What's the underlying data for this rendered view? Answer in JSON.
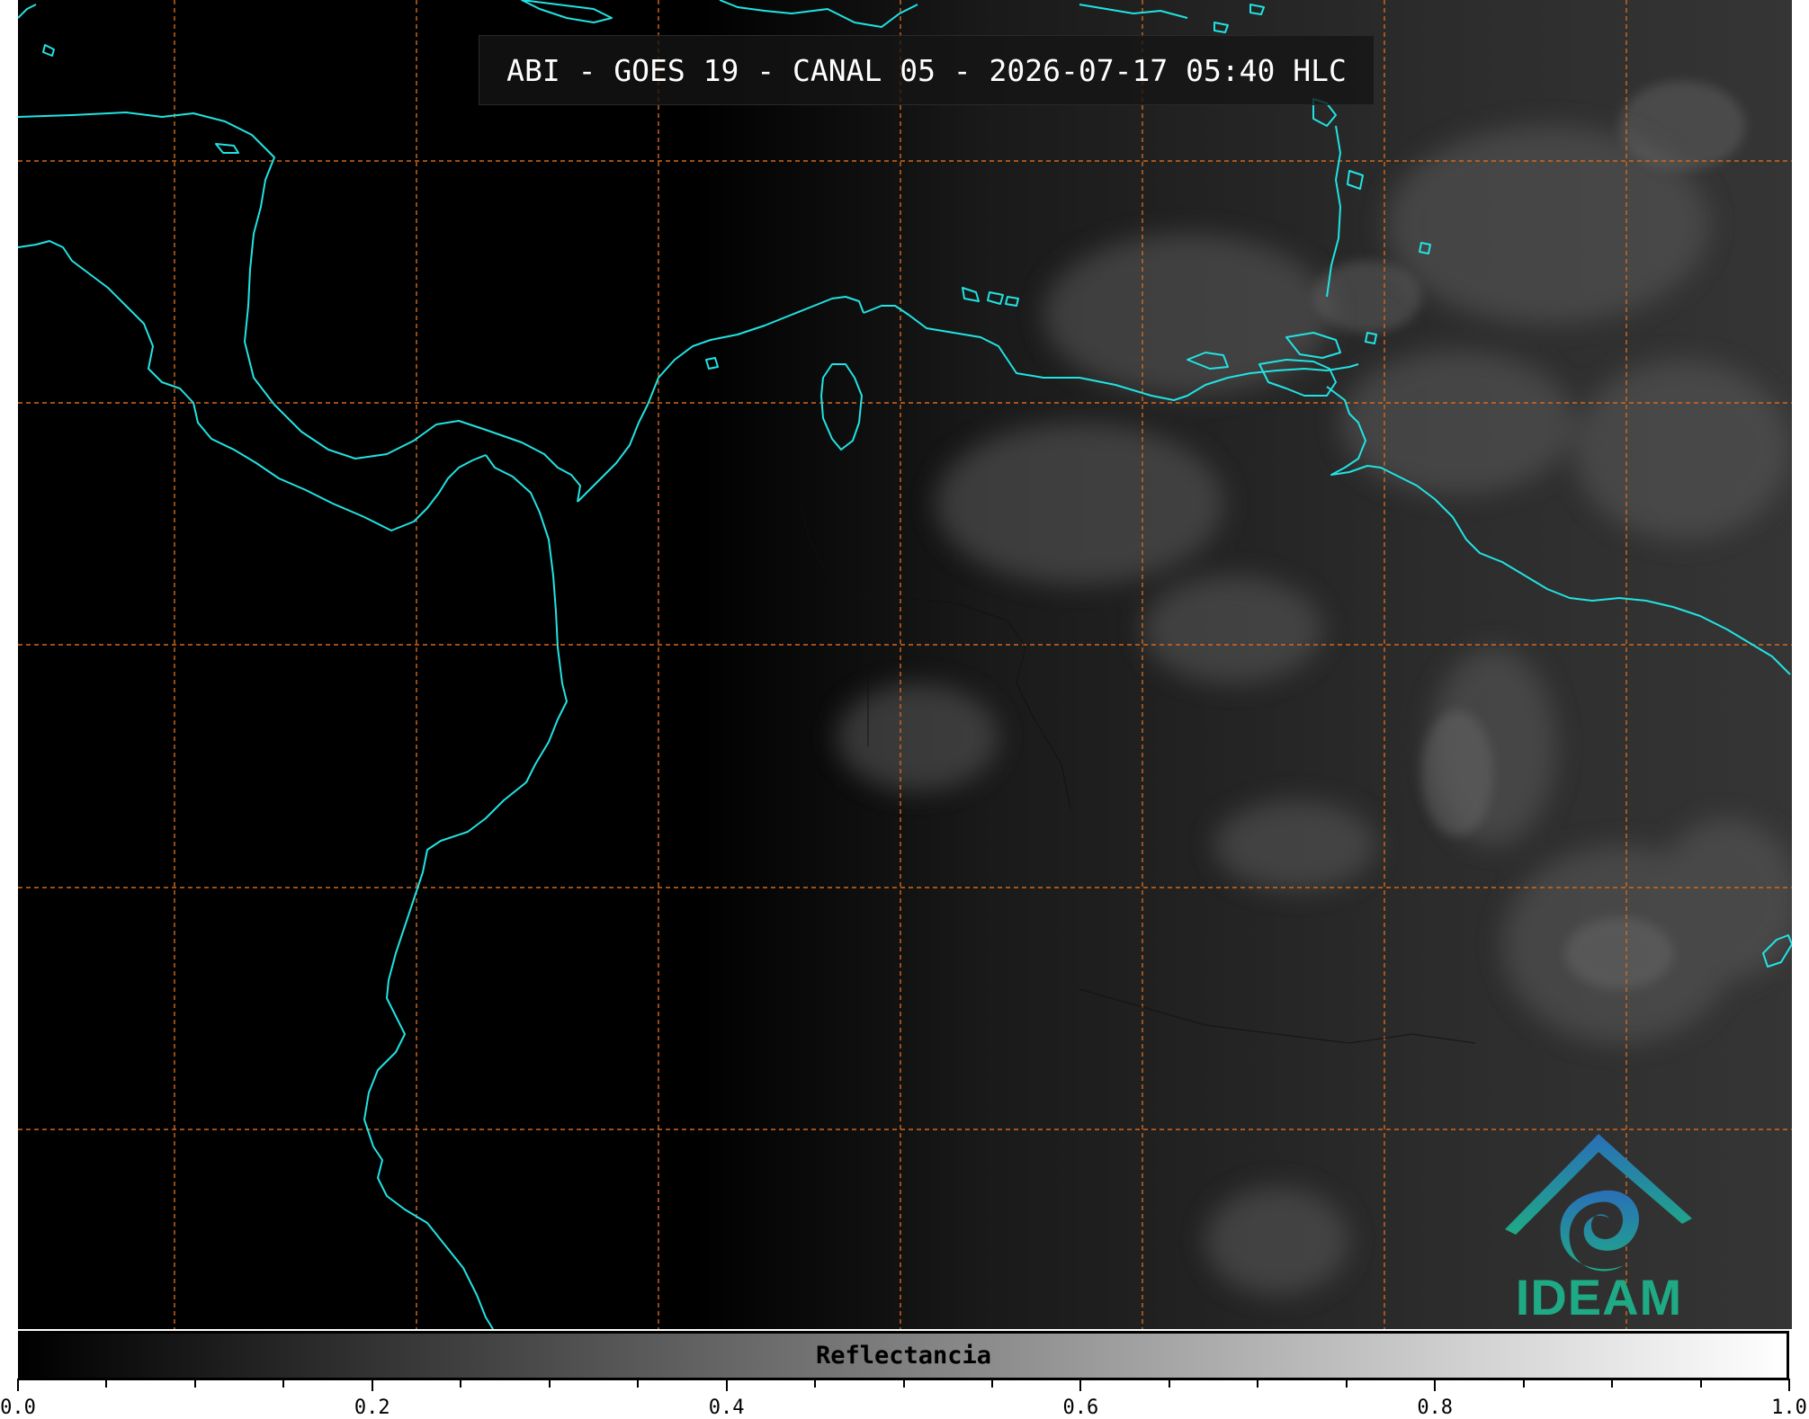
{
  "title": "ABI - GOES 19 - CANAL 05 - 2026-07-17 05:40 HLC",
  "colorbar": {
    "label": "Reflectancia",
    "min": 0.0,
    "max": 1.0,
    "tick_labels": [
      "0.0",
      "0.2",
      "0.4",
      "0.6",
      "0.8",
      "1.0"
    ],
    "minor_divisions": 20,
    "start_color": "#000000",
    "end_color": "#ffffff"
  },
  "logo": {
    "text": "IDEAM"
  },
  "colors": {
    "coastline": "#22e3e3",
    "grid": "#d2691e",
    "background": "#000000",
    "logo_blue": "#2a6fb8",
    "logo_green": "#1faa86"
  },
  "grid": {
    "style": "dashed",
    "meridians": 7,
    "parallels": 5
  }
}
